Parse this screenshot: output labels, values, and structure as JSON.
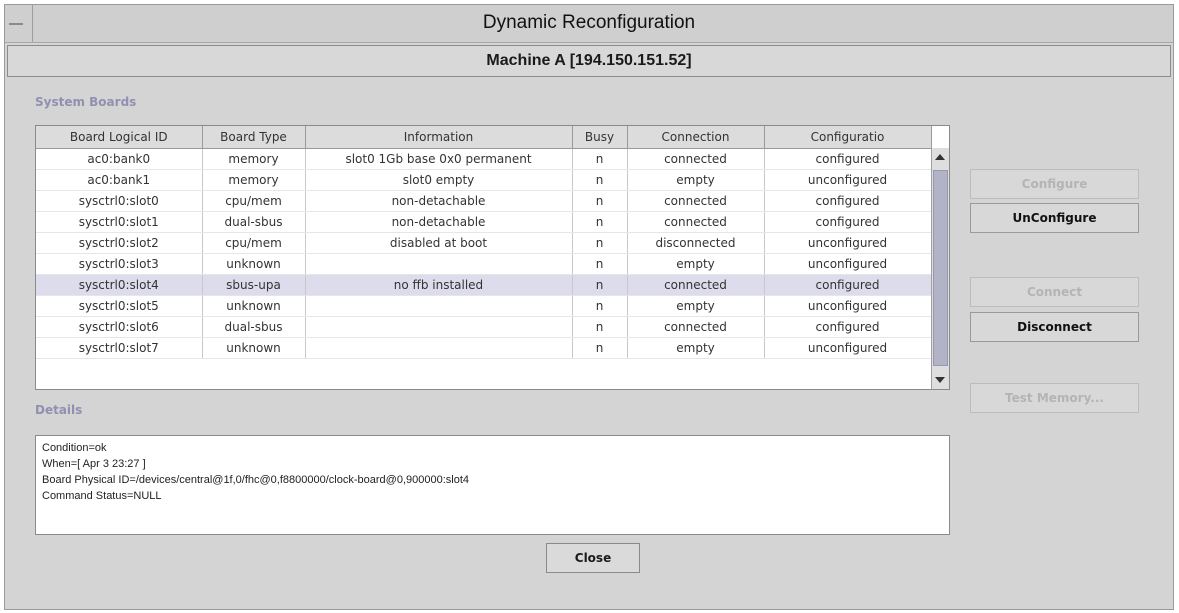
{
  "window": {
    "title": "Dynamic Reconfiguration",
    "machine": "Machine A [194.150.151.52]"
  },
  "system_boards": {
    "label": "System Boards",
    "columns": [
      "Board Logical ID",
      "Board Type",
      "Information",
      "Busy",
      "Connection",
      "Configuratio"
    ],
    "rows": [
      [
        "ac0:bank0",
        "memory",
        "slot0 1Gb base 0x0 permanent",
        "n",
        "connected",
        "configured"
      ],
      [
        "ac0:bank1",
        "memory",
        "slot0 empty",
        "n",
        "empty",
        "unconfigured"
      ],
      [
        "sysctrl0:slot0",
        "cpu/mem",
        "non-detachable",
        "n",
        "connected",
        "configured"
      ],
      [
        "sysctrl0:slot1",
        "dual-sbus",
        "non-detachable",
        "n",
        "connected",
        "configured"
      ],
      [
        "sysctrl0:slot2",
        "cpu/mem",
        "disabled at boot",
        "n",
        "disconnected",
        "unconfigured"
      ],
      [
        "sysctrl0:slot3",
        "unknown",
        "",
        "n",
        "empty",
        "unconfigured"
      ],
      [
        "sysctrl0:slot4",
        "sbus-upa",
        "no ffb installed",
        "n",
        "connected",
        "configured"
      ],
      [
        "sysctrl0:slot5",
        "unknown",
        "",
        "n",
        "empty",
        "unconfigured"
      ],
      [
        "sysctrl0:slot6",
        "dual-sbus",
        "",
        "n",
        "connected",
        "configured"
      ],
      [
        "sysctrl0:slot7",
        "unknown",
        "",
        "n",
        "empty",
        "unconfigured"
      ]
    ],
    "selected_row": 6
  },
  "buttons": {
    "configure": "Configure",
    "unconfigure": "UnConfigure",
    "connect": "Connect",
    "disconnect": "Disconnect",
    "test_memory": "Test Memory...",
    "close": "Close"
  },
  "details": {
    "label": "Details",
    "lines": [
      "Condition=ok",
      "When=[ Apr 3 23:27 ]",
      "Board Physical ID=/devices/central@1f,0/fhc@0,f8800000/clock-board@0,900000:slot4",
      "Command Status=NULL"
    ]
  }
}
